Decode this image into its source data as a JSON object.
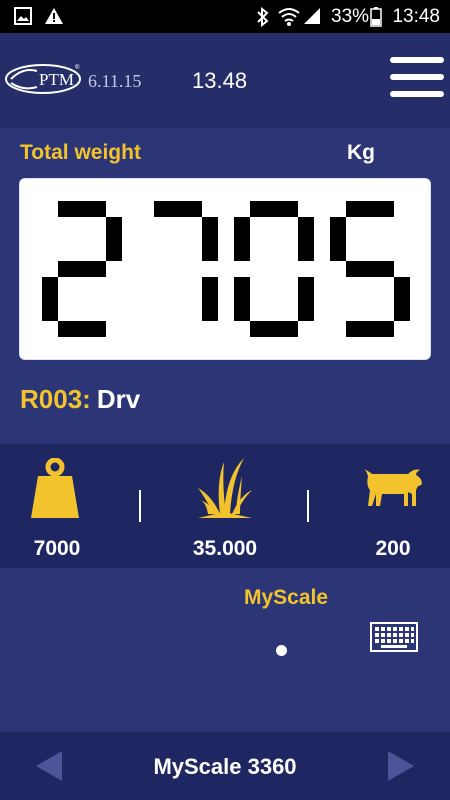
{
  "status_bar": {
    "battery_percent": "33%",
    "time": "13:48",
    "icons": [
      "image-icon",
      "warning-icon",
      "bluetooth-icon",
      "wifi-icon",
      "signal-icon",
      "battery-icon"
    ]
  },
  "header": {
    "logo_text": "PTM",
    "date": "6.11.15",
    "time": "13.48",
    "menu_icon": "hamburger-menu-icon"
  },
  "weight": {
    "label": "Total weight",
    "unit": "Kg",
    "value": "2705"
  },
  "recipe": {
    "code": "R003:",
    "name": "Drv"
  },
  "stats": [
    {
      "icon": "weight-icon",
      "value": "7000"
    },
    {
      "icon": "grass-icon",
      "value": "35.000"
    },
    {
      "icon": "cow-icon",
      "value": "200"
    }
  ],
  "device": {
    "title": "MyScale",
    "keyboard_icon": "keyboard-icon"
  },
  "footer": {
    "title": "MyScale 3360",
    "prev_icon": "arrow-left-icon",
    "next_icon": "arrow-right-icon"
  },
  "colors": {
    "background": "#2c3677",
    "band": "#1f2763",
    "accent": "#f2c32c",
    "display": "#ffffff"
  }
}
